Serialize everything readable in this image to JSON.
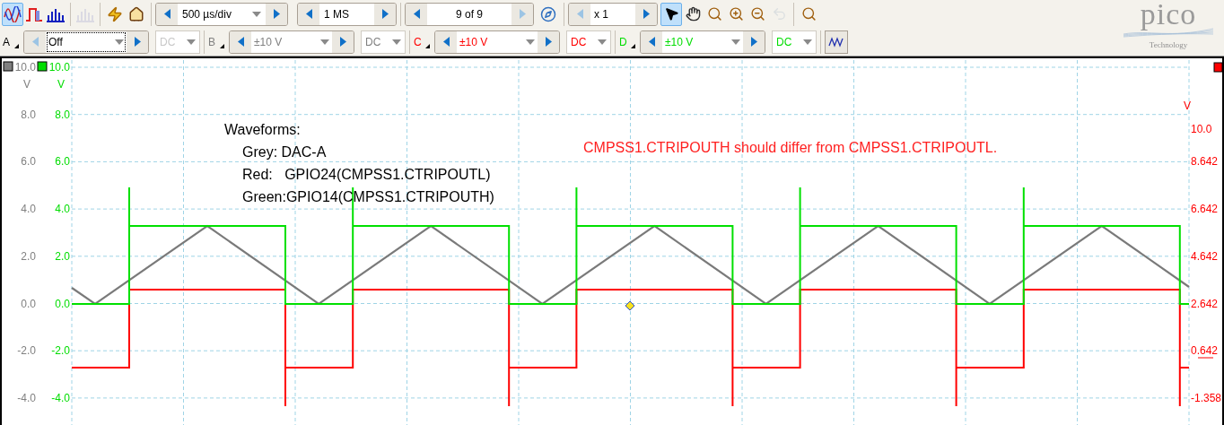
{
  "toolbar": {
    "view_buttons": [
      {
        "kind": "scope",
        "selected": true,
        "disabled": false
      },
      {
        "kind": "persistence",
        "selected": false,
        "disabled": false
      },
      {
        "kind": "spectrum",
        "selected": false,
        "disabled": false
      },
      {
        "kind": "spectrum",
        "selected": false,
        "disabled": true
      },
      {
        "kind": "trigger",
        "selected": false,
        "disabled": false
      },
      {
        "kind": "home",
        "selected": false,
        "disabled": false
      }
    ],
    "timebase": "500 µs/div",
    "samples": "1 MS",
    "buffer": {
      "value": "9 of 9",
      "next_disabled": true
    },
    "zoom_factor": {
      "value": "x 1",
      "prev_disabled": true
    },
    "tools": [
      {
        "kind": "pointer",
        "selected": true,
        "disabled": false
      },
      {
        "kind": "hand",
        "selected": false,
        "disabled": false
      },
      {
        "kind": "zoom_area",
        "selected": false,
        "disabled": false
      },
      {
        "kind": "zoom_in",
        "selected": false,
        "disabled": false
      },
      {
        "kind": "zoom_out",
        "selected": false,
        "disabled": false
      },
      {
        "kind": "undo",
        "selected": false,
        "disabled": true
      },
      {
        "kind": "zoom_fit",
        "selected": false,
        "disabled": false
      }
    ]
  },
  "logo": {
    "name": "pico",
    "tagline": "Technology"
  },
  "channels": [
    {
      "name": "A",
      "color": "#000000",
      "range": "Off",
      "coupling": "DC",
      "enabled": false
    },
    {
      "name": "B",
      "color": "#808080",
      "range": "±10 V",
      "coupling": "DC",
      "enabled": true
    },
    {
      "name": "C",
      "color": "#ff0000",
      "range": "±10 V",
      "coupling": "DC",
      "enabled": true
    },
    {
      "name": "D",
      "color": "#00dd00",
      "range": "±10 V",
      "coupling": "DC",
      "enabled": true
    }
  ],
  "plot": {
    "left_axes": [
      {
        "color": "#808080",
        "unit": "V",
        "ticks": [
          "10.0",
          "8.0",
          "6.0",
          "4.0",
          "2.0",
          "0.0",
          "-2.0",
          "-4.0"
        ]
      },
      {
        "color": "#00dd00",
        "unit": "V",
        "ticks": [
          "10.0",
          "8.0",
          "6.0",
          "4.0",
          "2.0",
          "0.0",
          "-2.0",
          "-4.0"
        ]
      }
    ],
    "right_axis": {
      "color": "#ff0000",
      "unit": "V",
      "ticks": [
        "10.0",
        "8.642",
        "6.642",
        "4.642",
        "2.642",
        "0.642",
        "-1.358"
      ]
    },
    "legend": [
      "Waveforms:",
      "Grey: DAC-A",
      "Red:   GPIO24(CMPSS1.CTRIPOUTL)",
      "Green:GPIO14(CMPSS1.CTRIPOUTH)"
    ],
    "note": {
      "text": "CMPSS1.CTRIPOUTH should differ from CMPSS1.CTRIPOUTL.",
      "color": "#ff2020"
    }
  }
}
